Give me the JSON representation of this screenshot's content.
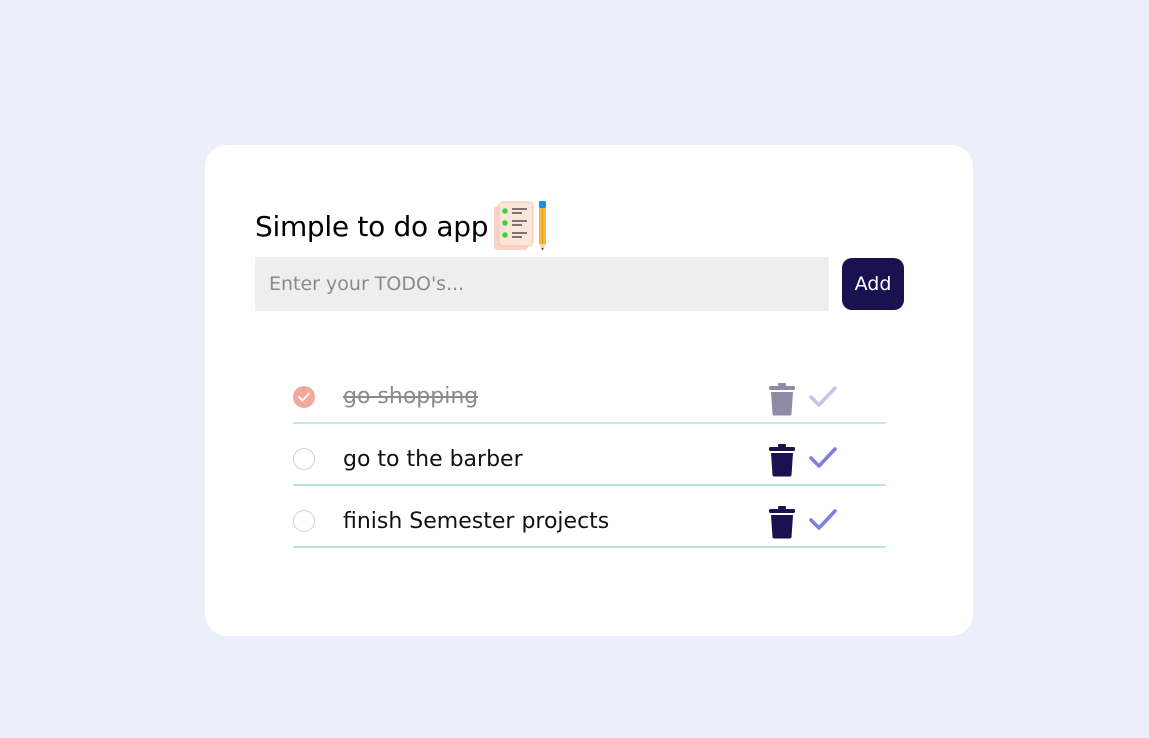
{
  "app": {
    "title": "Simple to do app",
    "title_icon": "checklist-pencil-icon"
  },
  "input": {
    "placeholder": "Enter your TODO's...",
    "value": ""
  },
  "add_button": {
    "label": "Add"
  },
  "colors": {
    "background": "#eaeff9",
    "card": "#ffffff",
    "accent_dark": "#1a1250",
    "check_accent": "#7b7fe0",
    "done_circle": "#f4a79b",
    "divider": "#b8e4e4"
  },
  "todos": [
    {
      "text": "go shopping",
      "done": true
    },
    {
      "text": "go to the barber",
      "done": false
    },
    {
      "text": "finish Semester projects",
      "done": false
    }
  ]
}
